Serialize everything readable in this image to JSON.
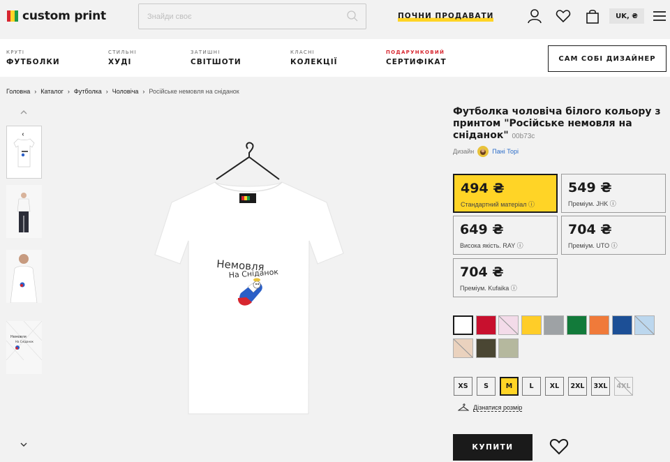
{
  "header": {
    "logo_text": "custom print",
    "logo_colors": [
      "#d7262f",
      "#ffd426",
      "#1e9b48"
    ],
    "search_placeholder": "Знайди своє",
    "cta_label": "ПОЧНИ ПРОДАВАТИ",
    "lang_label": "UK, ₴",
    "icons": [
      "user-icon",
      "heart-icon",
      "bag-icon",
      "menu-icon"
    ]
  },
  "nav": {
    "items": [
      {
        "small": "КРУТІ",
        "big": "ФУТБОЛКИ"
      },
      {
        "small": "СТИЛЬНІ",
        "big": "ХУДІ"
      },
      {
        "small": "ЗАТИШНІ",
        "big": "СВІТШОТИ"
      },
      {
        "small": "КЛАСНІ",
        "big": "КОЛЕКЦІЇ"
      },
      {
        "small": "ПОДАРУНКОВИЙ",
        "big": "СЕРТИФІКАТ"
      }
    ],
    "designer_button": "САМ СОБІ ДИЗАЙНЕР"
  },
  "breadcrumb": [
    "Головна",
    "Каталог",
    "Футболка",
    "Чоловіча",
    "Російське немовля на сніданок"
  ],
  "product": {
    "title": "Футболка чоловіча білого кольору з принтом \"Російське немовля на сніданок\"",
    "code": "00b73c",
    "design_label": "Дизайн",
    "author": "Пані Торі",
    "print_text_line1": "Немовля",
    "print_text_line2": "На Сніданок"
  },
  "prices": [
    {
      "amount": "494 ₴",
      "label": "Стандартний матеріал",
      "selected": true
    },
    {
      "amount": "549 ₴",
      "label": "Преміум. JHK",
      "selected": false
    },
    {
      "amount": "649 ₴",
      "label": "Висока якість. RAY",
      "selected": false
    },
    {
      "amount": "704 ₴",
      "label": "Преміум. UTO",
      "selected": false
    },
    {
      "amount": "704 ₴",
      "label": "Преміум. Kufaika",
      "selected": false
    }
  ],
  "colors": [
    "#ffffff",
    "#c8102e",
    "#f3dbe9",
    "#ffcd28",
    "#9ea2a5",
    "#127a3a",
    "#f07a3a",
    "#1c4f96",
    "#bcd7ee",
    "#ead2be",
    "#4a4633",
    "#b5b89e"
  ],
  "sizes": [
    {
      "label": "XS",
      "selected": false,
      "disabled": false
    },
    {
      "label": "S",
      "selected": false,
      "disabled": false
    },
    {
      "label": "M",
      "selected": true,
      "disabled": false
    },
    {
      "label": "L",
      "selected": false,
      "disabled": false
    },
    {
      "label": "XL",
      "selected": false,
      "disabled": false
    },
    {
      "label": "2XL",
      "selected": false,
      "disabled": false
    },
    {
      "label": "3XL",
      "selected": false,
      "disabled": false
    },
    {
      "label": "4XL",
      "selected": false,
      "disabled": true
    }
  ],
  "size_guide_label": "Дізнатися розмір",
  "buy_label": "КУПИТИ"
}
